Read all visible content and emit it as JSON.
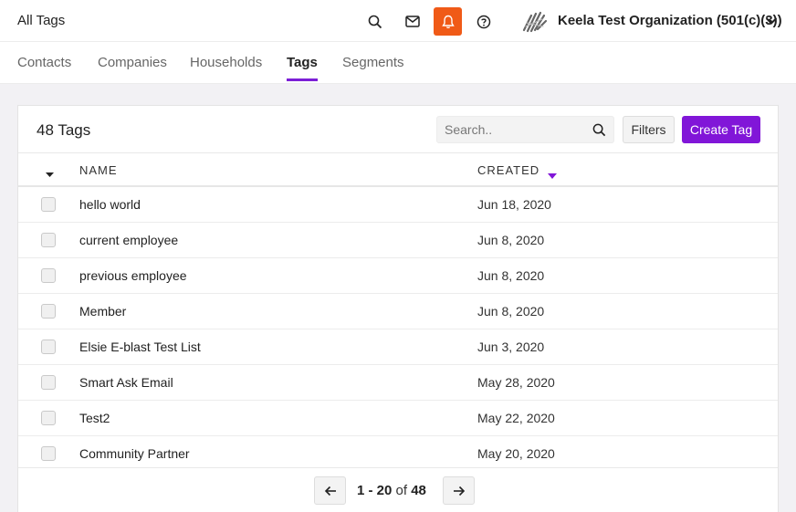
{
  "header": {
    "title": "All Tags",
    "icons": [
      "search-icon",
      "mail-icon",
      "bell-icon",
      "help-icon"
    ],
    "org_name": "Keela Test Organization (501(c)(3))",
    "accent": "#f05a17"
  },
  "tabs": [
    {
      "label": "Contacts",
      "active": false
    },
    {
      "label": "Companies",
      "active": false
    },
    {
      "label": "Households",
      "active": false
    },
    {
      "label": "Tags",
      "active": true
    },
    {
      "label": "Segments",
      "active": false
    }
  ],
  "toolbar": {
    "count_label": "48 Tags",
    "search_placeholder": "Search..",
    "filters_label": "Filters",
    "create_label": "Create Tag",
    "brand_color": "#8116d8"
  },
  "table": {
    "columns": [
      "NAME",
      "CREATED"
    ],
    "rows": [
      {
        "name": "hello world",
        "created": "Jun 18, 2020"
      },
      {
        "name": "current employee",
        "created": "Jun 8, 2020"
      },
      {
        "name": "previous employee",
        "created": "Jun 8, 2020"
      },
      {
        "name": "Member",
        "created": "Jun 8, 2020"
      },
      {
        "name": "Elsie E-blast Test List",
        "created": "Jun 3, 2020"
      },
      {
        "name": "Smart Ask Email",
        "created": "May 28, 2020"
      },
      {
        "name": "Test2",
        "created": "May 22, 2020"
      },
      {
        "name": "Community Partner",
        "created": "May 20, 2020"
      }
    ]
  },
  "pagination": {
    "range": "1 - 20",
    "of_label": "of",
    "total": "48"
  }
}
